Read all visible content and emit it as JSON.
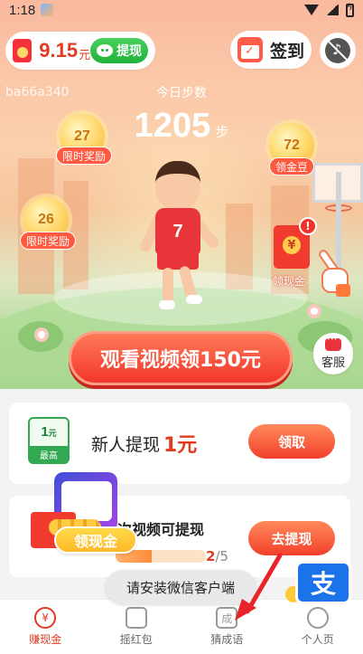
{
  "status_bar": {
    "time": "1:18"
  },
  "header": {
    "balance_value": "9.15",
    "balance_unit": "元",
    "withdraw_label": "提现",
    "signin_label": "签到"
  },
  "user": {
    "id": "ba66a340"
  },
  "steps": {
    "title": "今日步数",
    "value": "1205",
    "unit": "步"
  },
  "bubbles": [
    {
      "num": "27",
      "label": "限时奖励"
    },
    {
      "num": "72",
      "label": "领金豆"
    },
    {
      "num": "26",
      "label": "限时奖励"
    }
  ],
  "envelope": {
    "label": "领现金",
    "alert": "!"
  },
  "main_button": {
    "label": "观看视频领150元"
  },
  "service": {
    "label": "客服"
  },
  "card_newuser": {
    "coupon_amount": "1",
    "coupon_unit": "元",
    "coupon_footer": "最高",
    "text": "新人提现",
    "amount": "1元",
    "button": "领取"
  },
  "card_progress": {
    "title": "次视频可提现",
    "current": "2",
    "total": "/5",
    "progress": 0.4,
    "button": "去提现",
    "promo_label": "领现金"
  },
  "toast": {
    "text": "请安装微信客户端"
  },
  "alipay": {
    "glyph": "支"
  },
  "nav": [
    {
      "label": "赚现金",
      "icon_glyph": "¥",
      "active": true
    },
    {
      "label": "摇红包",
      "icon_glyph": "",
      "active": false
    },
    {
      "label": "猜成语",
      "icon_glyph": "成",
      "active": false
    },
    {
      "label": "个人页",
      "icon_glyph": "",
      "active": false
    }
  ],
  "colors": {
    "accent": "#e23b22",
    "wechat_green": "#20b23b",
    "alipay_blue": "#1a73e8"
  }
}
